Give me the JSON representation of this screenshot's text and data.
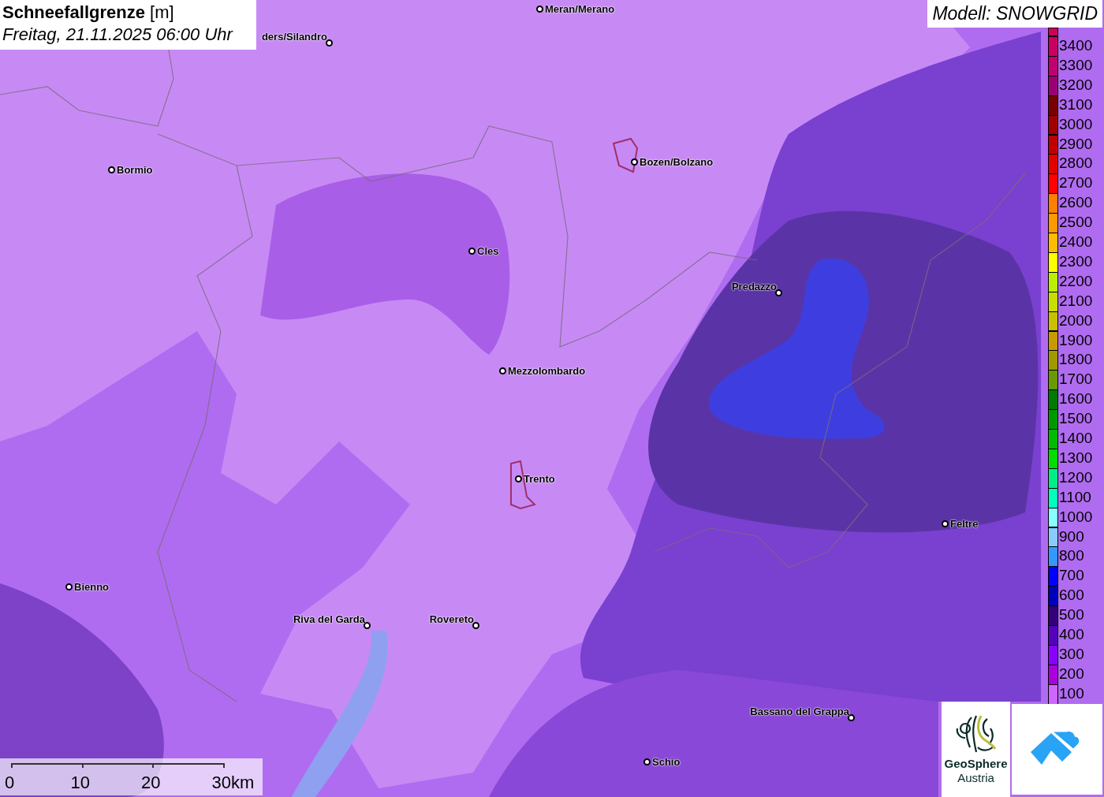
{
  "title": {
    "name": "Schneefallgrenze",
    "unit": "[m]",
    "date": "Freitag, 21.11.2025 06:00 Uhr"
  },
  "model": "Modell: SNOWGRID",
  "cities": [
    {
      "name": "Meran/Merano"
    },
    {
      "name": "ders/Silandro"
    },
    {
      "name": "Bormio"
    },
    {
      "name": "Bozen/Bolzano"
    },
    {
      "name": "Cles"
    },
    {
      "name": "Predazzo"
    },
    {
      "name": "Mezzolombardo"
    },
    {
      "name": "Trento"
    },
    {
      "name": "Feltre"
    },
    {
      "name": "Bienno"
    },
    {
      "name": "Riva del Garda"
    },
    {
      "name": "Rovereto"
    },
    {
      "name": "Bassano del Grappa"
    },
    {
      "name": "Schio"
    }
  ],
  "legend": [
    {
      "label": "3400",
      "color": "#c8005f"
    },
    {
      "label": "3300",
      "color": "#c0006e"
    },
    {
      "label": "3200",
      "color": "#9a0074"
    },
    {
      "label": "3100",
      "color": "#780000"
    },
    {
      "label": "3000",
      "color": "#a00000"
    },
    {
      "label": "2900",
      "color": "#c00000"
    },
    {
      "label": "2800",
      "color": "#e00000"
    },
    {
      "label": "2700",
      "color": "#ff0000"
    },
    {
      "label": "2600",
      "color": "#ff7f00"
    },
    {
      "label": "2500",
      "color": "#ff9900"
    },
    {
      "label": "2400",
      "color": "#ffbb00"
    },
    {
      "label": "2300",
      "color": "#ffff00"
    },
    {
      "label": "2200",
      "color": "#bbee00"
    },
    {
      "label": "2100",
      "color": "#c8dd00"
    },
    {
      "label": "2000",
      "color": "#c8c000"
    },
    {
      "label": "1900",
      "color": "#c89a00"
    },
    {
      "label": "1800",
      "color": "#a09a00"
    },
    {
      "label": "1700",
      "color": "#6a9a00"
    },
    {
      "label": "1600",
      "color": "#007a00"
    },
    {
      "label": "1500",
      "color": "#009a00"
    },
    {
      "label": "1400",
      "color": "#00bb00"
    },
    {
      "label": "1300",
      "color": "#00dd00"
    },
    {
      "label": "1200",
      "color": "#00ee88"
    },
    {
      "label": "1100",
      "color": "#00ffbb"
    },
    {
      "label": "1000",
      "color": "#88ffff"
    },
    {
      "label": "900",
      "color": "#88ccff"
    },
    {
      "label": "800",
      "color": "#3399ff"
    },
    {
      "label": "700",
      "color": "#0000ff"
    },
    {
      "label": "600",
      "color": "#0000bb"
    },
    {
      "label": "500",
      "color": "#330077"
    },
    {
      "label": "400",
      "color": "#5500bb"
    },
    {
      "label": "300",
      "color": "#8800ff"
    },
    {
      "label": "200",
      "color": "#aa00dd"
    },
    {
      "label": "100",
      "color": "#cc66ff"
    }
  ],
  "scale": [
    "0",
    "10",
    "20",
    "30km"
  ],
  "logo": {
    "line1": "GeoSphere",
    "line2": "Austria"
  }
}
